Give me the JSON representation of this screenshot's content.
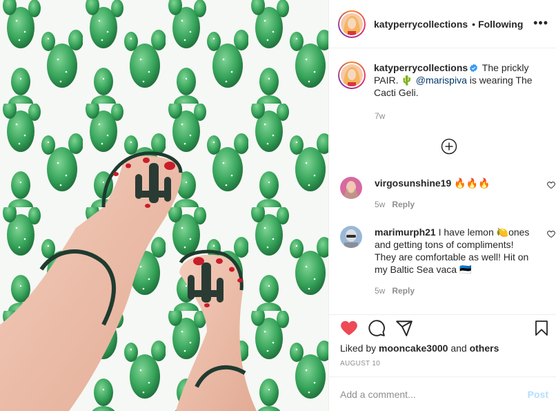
{
  "post": {
    "username": "katyperrycollections",
    "dot": "•",
    "follow_state": "Following",
    "more": "•••",
    "caption_text_1": " The prickly PAIR. ",
    "caption_emoji": "🌵",
    "caption_mention": "@marispiva",
    "caption_text_2": " is wearing The Cacti Geli.",
    "caption_time": "7w"
  },
  "comments": [
    {
      "username": "virgosunshine19",
      "text": " 🔥🔥🔥",
      "time": "5w",
      "reply_label": "Reply"
    },
    {
      "username": "marimurph21",
      "text": " I have lemon 🍋ones and getting tons of compliments! They are comfortable as well! Hit on my Baltic Sea vaca 🇪🇪",
      "time": "5w",
      "reply_label": "Reply"
    }
  ],
  "engagement": {
    "liked_prefix": "Liked by ",
    "liked_user": "mooncake3000",
    "liked_and": " and ",
    "liked_others": "others",
    "date": "AUGUST 10"
  },
  "composer": {
    "placeholder": "Add a comment...",
    "post_label": "Post"
  },
  "colors": {
    "heart": "#ed4956",
    "mention": "#00376b",
    "verified": "#3897f0",
    "post_disabled": "#b2dffc",
    "cactus": "#2e8b48"
  },
  "icons": [
    "more-options-icon",
    "verified-badge-icon",
    "load-more-comments-icon",
    "like-icon",
    "comment-icon",
    "share-icon",
    "save-icon",
    "comment-like-icon"
  ]
}
